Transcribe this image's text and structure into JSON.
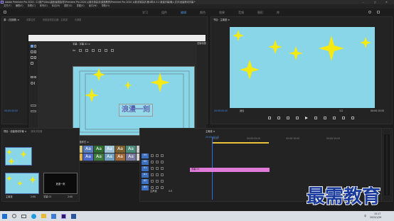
{
  "window": {
    "title": "Adobe Premiere Pro 2020 - C:\\用户\\Kiku\\桌面\\最需素材\\Premiere Pro 2020 从新手到高手\\最需教育\\Premiere Pro 2020 从新手到高手\\第4章\\4.3.2 新建字幕\\输入文字\\创建滚动字幕 *",
    "controls": [
      "–",
      "□",
      "✕"
    ]
  },
  "menu": [
    "文件(F)",
    "编辑(E)",
    "剪辑(C)",
    "序列(S)",
    "标记(M)",
    "图形(G)",
    "视图(V)",
    "窗口(W)",
    "帮助(H)"
  ],
  "workspaces": [
    "学习",
    "组件",
    "编辑",
    "颜色",
    "效果",
    "音频",
    "图形",
    "库"
  ],
  "source_panel": {
    "tabs": [
      "源：(无剪辑) ≡",
      "效果控件",
      "音频剪辑混合器：主离道",
      "元数据"
    ],
    "timecode": "00:00:00:00"
  },
  "program_monitor": {
    "tab": "节目：主离道 ≡",
    "timecode": "00:00:00:00",
    "fit": "适合",
    "duration": "00:00:10:00",
    "zoom": "1/2"
  },
  "title_tool": {
    "window_title": "字幕：字幕 01 ≡",
    "font": "Aa",
    "subtitle_text": "浪漫一刻",
    "styles_tab": "旧版标题样式 ≡",
    "props_tab": "旧版标题属性 ≡",
    "align_tab": "对齐"
  },
  "project_panel": {
    "tabs": [
      "项目：创建滚动字幕 ≡",
      "媒体浏览器"
    ],
    "items": [
      {
        "name": "主离道",
        "duration": "2:00"
      },
      {
        "name": "字幕 01",
        "duration": "2:00",
        "label": "浪漫一刻"
      }
    ]
  },
  "timeline": {
    "tab": "主离道 ≡",
    "timecode": "00:00:00:00",
    "ruler": [
      "00:00",
      "00:00:05:00",
      "00:00:10:00",
      "00:00:15:00"
    ],
    "tracks": [
      "V3",
      "V2",
      "V1",
      "A1",
      "A2",
      "A3"
    ],
    "master": "主声道",
    "master_value": "0.0",
    "clip": "字幕 01"
  },
  "watermark": "最需教育",
  "taskbar": {
    "time": "15:17",
    "date": "2022/1/26",
    "lang": "中"
  },
  "colors": {
    "accent": "#3f8ef5",
    "clip": "#e07ad8",
    "sky": "#89d6e8",
    "star": "#f5ea13",
    "subtitle": "#c9c6f0",
    "playhead": "#2b70e6",
    "watermark": "#1a3a9c"
  }
}
